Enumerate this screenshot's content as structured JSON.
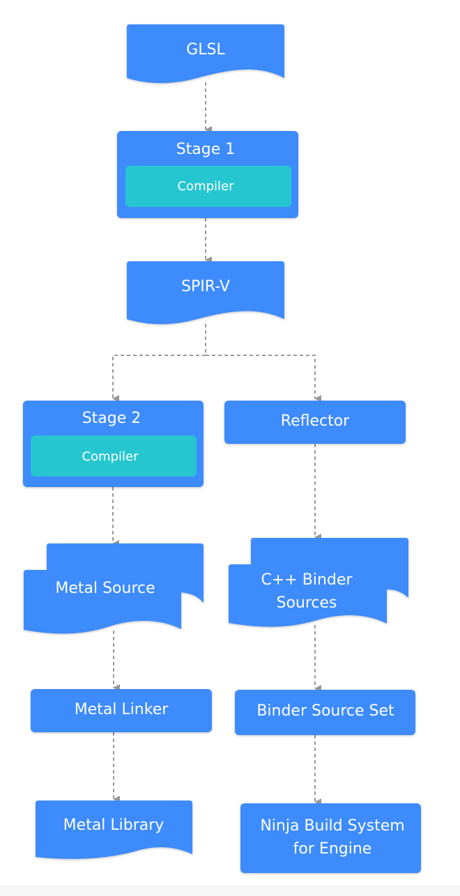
{
  "colors": {
    "node": "#3d8bfd",
    "inner": "#26c6d0",
    "edge": "#999999"
  },
  "nodes": {
    "glsl": "GLSL",
    "stage1": {
      "title": "Stage 1",
      "inner": "Compiler"
    },
    "spirv": "SPIR-V",
    "stage2": {
      "title": "Stage 2",
      "inner": "Compiler"
    },
    "reflector": "Reflector",
    "metal_source": "Metal Source",
    "cpp_binder": {
      "line1": "C++ Binder",
      "line2": "Sources"
    },
    "metal_linker": "Metal Linker",
    "binder_source_set": "Binder Source Set",
    "metal_library": "Metal Library",
    "ninja": {
      "line1": "Ninja Build System",
      "line2": "for Engine"
    }
  }
}
